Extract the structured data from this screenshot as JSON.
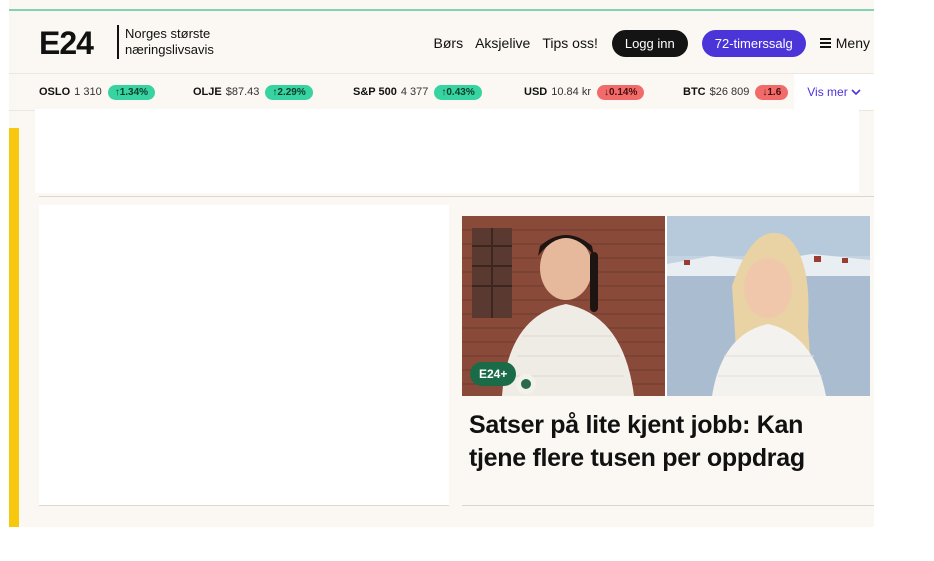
{
  "header": {
    "logo": "E24",
    "tagline_line1": "Norges største",
    "tagline_line2": "næringslivsavis",
    "nav": [
      "Børs",
      "Aksjelive",
      "Tips oss!"
    ],
    "login_label": "Logg inn",
    "sale_label": "72-timerssalg",
    "menu_label": "Meny"
  },
  "ticker": {
    "items": [
      {
        "name": "OSLO",
        "value": "1 310",
        "change": "↑1.34%",
        "direction": "up"
      },
      {
        "name": "OLJE",
        "value": "$87.43",
        "change": "↑2.29%",
        "direction": "up"
      },
      {
        "name": "S&P 500",
        "value": "4 377",
        "change": "↑0.43%",
        "direction": "up"
      },
      {
        "name": "USD",
        "value": "10.84 kr",
        "change": "↓0.14%",
        "direction": "down"
      },
      {
        "name": "BTC",
        "value": "$26 809",
        "change": "↓1.6",
        "direction": "down"
      }
    ],
    "more_label": "Vis mer"
  },
  "article": {
    "badge": "E24+",
    "title": "Satser på lite kjent jobb: Kan tjene flere tusen per oppdrag"
  },
  "colors": {
    "accent_purple": "#4b34d8",
    "up_green": "#37d3a0",
    "down_red": "#f26b6b",
    "premium_green": "#1a6b48",
    "rail_yellow": "#f6c90e",
    "page_bg": "#fbf8f3"
  }
}
